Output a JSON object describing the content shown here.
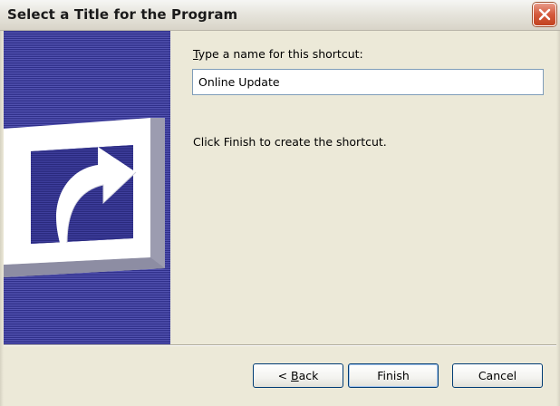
{
  "window": {
    "title": "Select a Title for the Program"
  },
  "banner": {
    "icon": "shortcut-arrow-icon",
    "color": "#3b3b96"
  },
  "content": {
    "prompt_prefix": "T",
    "prompt_rest": "ype a name for this shortcut:",
    "name_value": "Online Update",
    "finish_message": "Click Finish to create the shortcut."
  },
  "buttons": {
    "back_prefix": "< ",
    "back_mnemonic": "B",
    "back_rest": "ack",
    "finish": "Finish",
    "cancel": "Cancel"
  },
  "colors": {
    "dialog_bg": "#ECE9D8",
    "close_button": "#d45a3c",
    "input_border": "#7f9db9",
    "button_border": "#003c74"
  }
}
